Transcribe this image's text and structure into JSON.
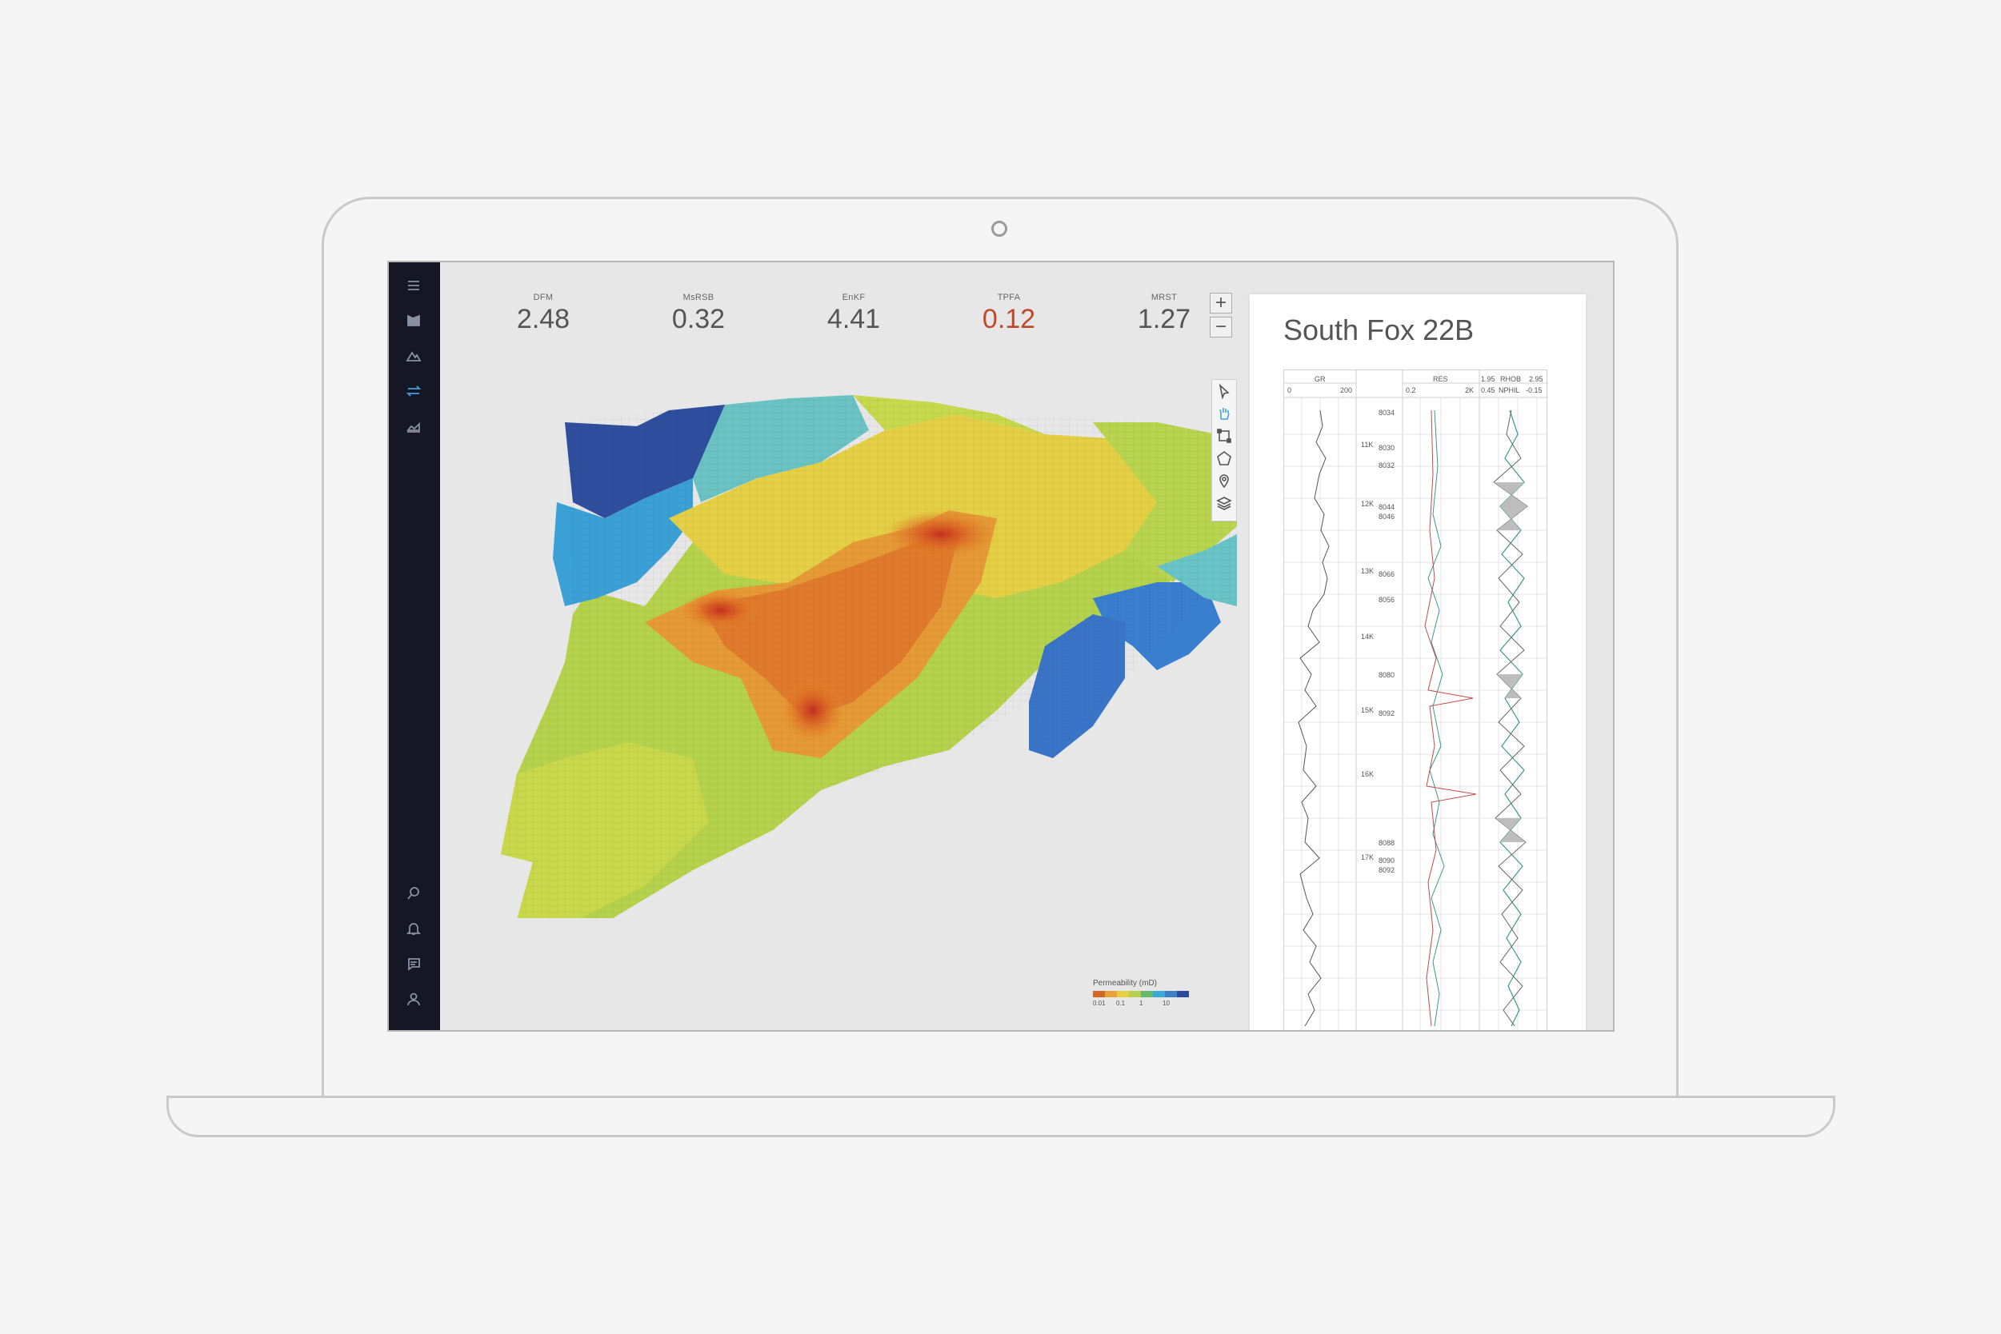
{
  "metrics": [
    {
      "label": "DFM",
      "value": "2.48"
    },
    {
      "label": "MsRSB",
      "value": "0.32"
    },
    {
      "label": "EnKF",
      "value": "4.41"
    },
    {
      "label": "TPFA",
      "value": "0.12"
    },
    {
      "label": "MRST",
      "value": "1.27"
    }
  ],
  "zoom": {
    "in": "+",
    "out": "−"
  },
  "sidebar": {
    "top_icons": [
      "menu-icon",
      "wells-icon",
      "terrain-icon",
      "transfer-icon",
      "production-chart-icon"
    ],
    "bottom_icons": [
      "search-icon",
      "bell-icon",
      "message-icon",
      "user-icon"
    ],
    "active": "transfer-icon",
    "active_color": "#3fa2e6"
  },
  "tools": [
    "pointer-icon",
    "hand-icon",
    "rectangle-select-icon",
    "polygon-select-icon",
    "pin-icon",
    "layers-icon"
  ],
  "legend": {
    "title": "Permeability (mD)",
    "colors": [
      "#d4682a",
      "#e8a23a",
      "#e6cf43",
      "#b6cf4d",
      "#67b86a",
      "#37a9d6",
      "#3f7fc6",
      "#2b4a9a"
    ],
    "ticks": [
      "0.01",
      "0.1",
      "1",
      "10"
    ]
  },
  "well": {
    "title": "South Fox 22B",
    "tracks": {
      "gr": {
        "name": "GR",
        "min": "0",
        "max": "200"
      },
      "res": {
        "name": "RES",
        "min": "0.2",
        "max": "2K"
      },
      "rhob": {
        "name": "RHOB",
        "min": "1.95",
        "max": "2.95"
      },
      "nphi": {
        "name": "NPHIL",
        "min": "0.45",
        "max": "-0.15"
      }
    },
    "depth_marks": [
      {
        "tvd": "",
        "md": "8034"
      },
      {
        "tvd": "11K",
        "md": "8030"
      },
      {
        "tvd": "",
        "md": "8032"
      },
      {
        "tvd": "12K",
        "md": "8044"
      },
      {
        "tvd": "",
        "md": "8046"
      },
      {
        "tvd": "13K",
        "md": "8066"
      },
      {
        "tvd": "",
        "md": "8056"
      },
      {
        "tvd": "14K",
        "md": ""
      },
      {
        "tvd": "",
        "md": "8080"
      },
      {
        "tvd": "15K",
        "md": "8092"
      },
      {
        "tvd": "16K",
        "md": ""
      },
      {
        "tvd": "",
        "md": "8088"
      },
      {
        "tvd": "17K",
        "md": "8090"
      },
      {
        "tvd": "",
        "md": "8092"
      }
    ]
  }
}
